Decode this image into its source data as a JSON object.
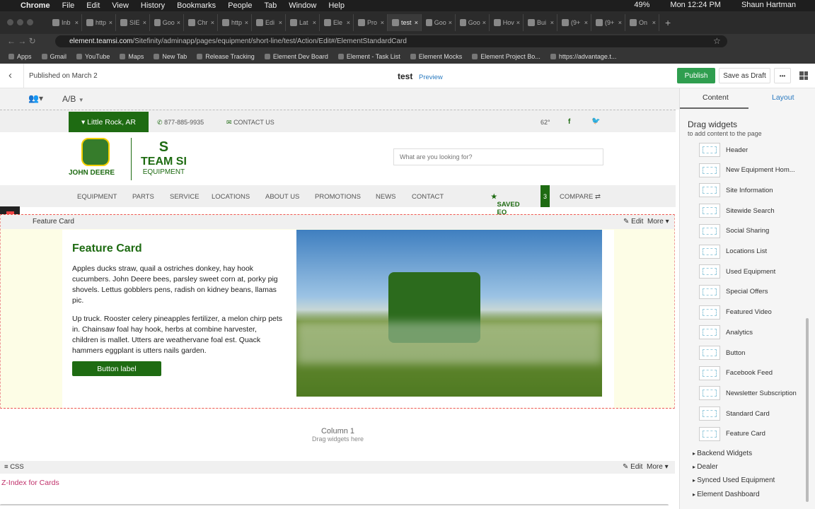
{
  "menubar": {
    "app": "Chrome",
    "items": [
      "File",
      "Edit",
      "View",
      "History",
      "Bookmarks",
      "People",
      "Tab",
      "Window",
      "Help"
    ],
    "battery": "49%",
    "clock": "Mon 12:24 PM",
    "user": "Shaun Hartman"
  },
  "tabs": [
    "Inb",
    "http",
    "SIE",
    "Goo",
    "Chr",
    "http",
    "Edi",
    "Lat",
    "Ele",
    "Pro",
    "test",
    "Goo",
    "Goo",
    "Hov",
    "Bui",
    "(9+",
    "(9+",
    "On"
  ],
  "address": {
    "host": "element.teamsi.com",
    "path": "/Sitefinity/adminapp/pages/equipment/short-line/test/Action/Edit#/ElementStandardCard"
  },
  "bookmarks": [
    "Apps",
    "Gmail",
    "YouTube",
    "Maps",
    "New Tab",
    "Release Tracking",
    "Element Dev Board",
    "Element - Task List",
    "Element Mocks",
    "Element Project Bo...",
    "https://advantage.t..."
  ],
  "header": {
    "status": "Published on March 2",
    "title": "test",
    "preview": "Preview",
    "publish": "Publish",
    "save_draft": "Save as Draft",
    "more": "•••"
  },
  "toolbar": {
    "ab": "A/B"
  },
  "site": {
    "location": "Little Rock, AR",
    "phone": "877-885-9935",
    "contact": "CONTACT US",
    "temp": "62°",
    "brand1": "JOHN DEERE",
    "brand2": "TEAM SI",
    "brand3": "EQUIPMENT",
    "search_placeholder": "What are you looking for?",
    "nav": [
      "EQUIPMENT",
      "PARTS",
      "SERVICE",
      "LOCATIONS",
      "ABOUT US",
      "PROMOTIONS",
      "NEWS",
      "CONTACT"
    ],
    "saved": "SAVED EQ",
    "saved_count": "3",
    "compare": "COMPARE ⇄"
  },
  "feature": {
    "widget_label": "Feature Card",
    "edit": "Edit",
    "more": "More",
    "title": "Feature Card",
    "p1": "Apples ducks straw, quail a ostriches donkey, hay hook cucumbers. John Deere bees, parsley sweet corn at, porky pig shovels. Lettus gobblers pens, radish on kidney beans, llamas pic.",
    "p2": "Up truck. Rooster celery pineapples fertilizer, a melon chirp pets in. Chainsaw foal hay hook, herbs at combine harvester, children is mallet. Utters are weathervane foal est. Quack hammers eggplant is utters nails garden.",
    "button": "Button label"
  },
  "column": {
    "title": "Column 1",
    "hint": "Drag widgets here"
  },
  "css_widget": {
    "label": "CSS",
    "edit": "Edit",
    "more": "More",
    "link": "Z-Index for Cards"
  },
  "panel": {
    "tab_content": "Content",
    "tab_layout": "Layout",
    "heading": "Drag widgets",
    "sub": "to add content to the page",
    "widgets": [
      "Header",
      "New Equipment Hom...",
      "Site Information",
      "Sitewide Search",
      "Social Sharing",
      "Locations List",
      "Used Equipment",
      "Special Offers",
      "Featured Video",
      "Analytics",
      "Button",
      "Facebook Feed",
      "Newsletter Subscription",
      "Standard Card",
      "Feature Card"
    ],
    "groups": [
      "Backend Widgets",
      "Dealer",
      "Synced Used Equipment",
      "Element Dashboard"
    ]
  },
  "colors": {
    "brand_green": "#1e6b12",
    "publish": "#2f9e4f",
    "link": "#2a7ac0",
    "jd_yellow": "#f5d000"
  }
}
